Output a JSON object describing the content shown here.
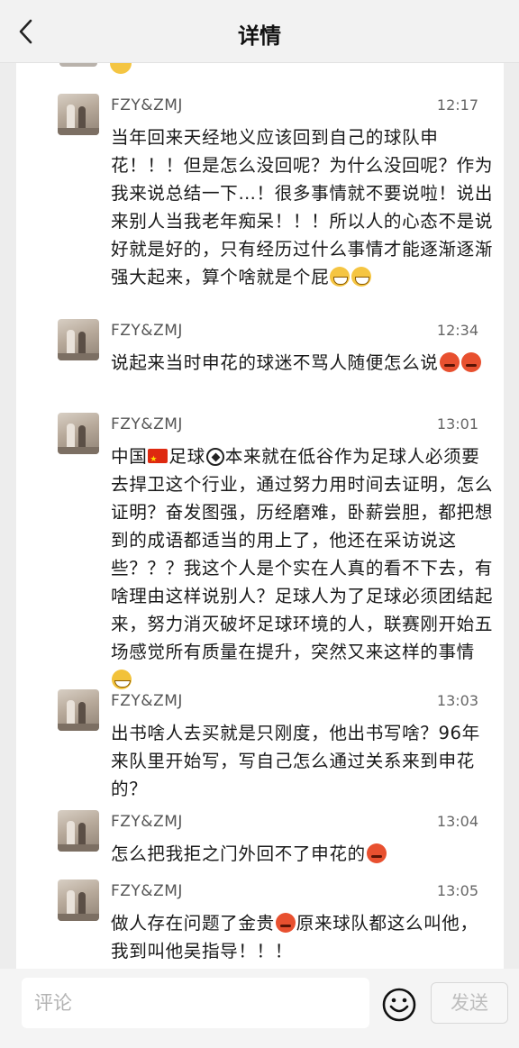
{
  "header": {
    "title": "详情"
  },
  "messages": [
    {
      "author": "FZY&ZMJ",
      "time": "12:17",
      "segments": [
        {
          "t": "当年回来天经地义应该回到自己的球队申花！！！但是怎么没回呢？为什么没回呢？作为我来说总结一下…！很多事情就不要说啦！说出来别人当我老年痴呆！！！所以人的心态不是说好就是好的，只有经历过什么事情才能逐渐逐渐强大起来，算个啥就是个屁"
        },
        {
          "e": "grin"
        },
        {
          "e": "grin"
        }
      ]
    },
    {
      "author": "FZY&ZMJ",
      "time": "12:34",
      "segments": [
        {
          "t": "说起来当时申花的球迷不骂人随便怎么说"
        },
        {
          "e": "angry"
        },
        {
          "e": "angry"
        }
      ]
    },
    {
      "author": "FZY&ZMJ",
      "time": "13:01",
      "segments": [
        {
          "t": "中国"
        },
        {
          "e": "flag"
        },
        {
          "t": "足球"
        },
        {
          "e": "ball"
        },
        {
          "t": "本来就在低谷作为足球人必须要去捍卫这个行业，通过努力用时间去证明，怎么证明？奋发图强，历经磨难，卧薪尝胆，都把想到的成语都适当的用上了，他还在采访说这些？？？我这个人是个实在人真的看不下去，有啥理由这样说别人？足球人为了足球必须团结起来，努力消灭破坏足球环境的人，联赛刚开始五场感觉所有质量在提升，突然又来这样的事情"
        },
        {
          "e": "laugh"
        }
      ]
    },
    {
      "author": "FZY&ZMJ",
      "time": "13:03",
      "segments": [
        {
          "t": "出书啥人去买就是只刚度，他出书写啥？96年来队里开始写，写自己怎么通过关系来到申花的？"
        }
      ]
    },
    {
      "author": "FZY&ZMJ",
      "time": "13:04",
      "segments": [
        {
          "t": "怎么把我拒之门外回不了申花的"
        },
        {
          "e": "angry"
        }
      ]
    },
    {
      "author": "FZY&ZMJ",
      "time": "13:05",
      "segments": [
        {
          "t": "做人存在问题了金贵"
        },
        {
          "e": "angry"
        },
        {
          "t": "原来球队都这么叫他，我到叫他吴指导！！！"
        }
      ]
    }
  ],
  "comment": {
    "placeholder": "评论",
    "send_label": "发送"
  },
  "icons": {
    "back": "chevron-left-icon",
    "emoji": "smiley-icon"
  }
}
